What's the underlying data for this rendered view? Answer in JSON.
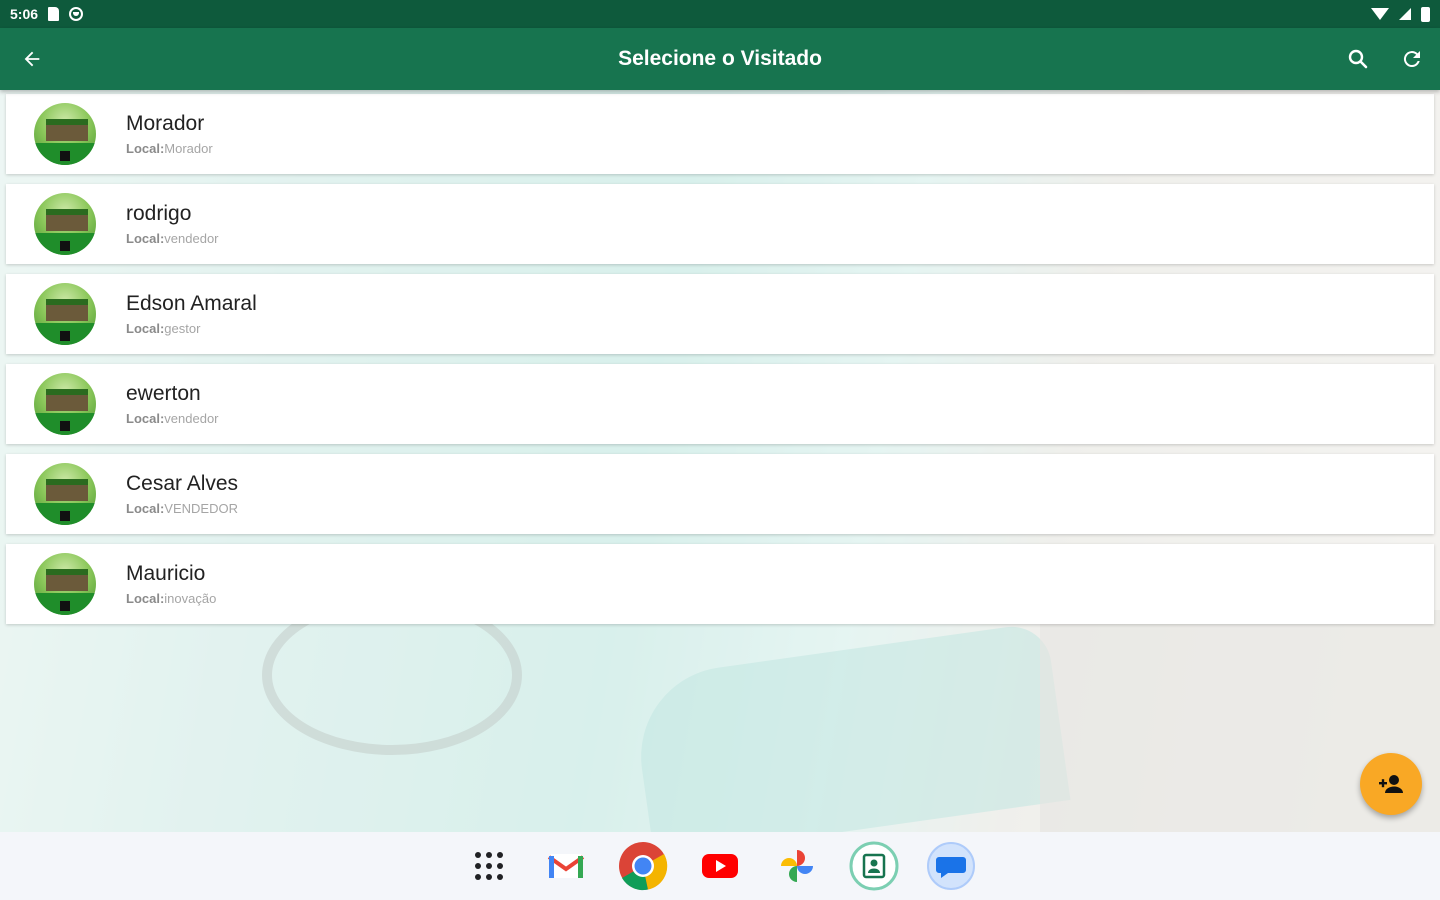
{
  "status_bar": {
    "time": "5:06",
    "icons": [
      "sdcard-icon",
      "shield-icon",
      "wifi-icon",
      "signal-icon",
      "battery-icon"
    ]
  },
  "app_bar": {
    "title": "Selecione o Visitado",
    "actions": [
      "back-arrow-icon",
      "search-icon",
      "refresh-icon"
    ]
  },
  "list": {
    "sub_label": "Local:",
    "items": [
      {
        "name": "Morador",
        "local": "Morador"
      },
      {
        "name": "rodrigo",
        "local": "vendedor"
      },
      {
        "name": "Edson Amaral",
        "local": "gestor"
      },
      {
        "name": "ewerton",
        "local": "vendedor"
      },
      {
        "name": "Cesar Alves",
        "local": "VENDEDOR"
      },
      {
        "name": "Mauricio",
        "local": "inovação"
      }
    ]
  },
  "fab": {
    "icon": "add-person-icon"
  },
  "taskbar": {
    "apps": [
      "app-grid-icon",
      "gmail-icon",
      "chrome-icon",
      "youtube-icon",
      "photos-icon",
      "visitor-app-icon",
      "messages-icon"
    ]
  },
  "colors": {
    "status_bar": "#0e5a3c",
    "app_bar": "#17744f",
    "fab": "#f9a825",
    "taskbar": "#f4f6fa"
  }
}
